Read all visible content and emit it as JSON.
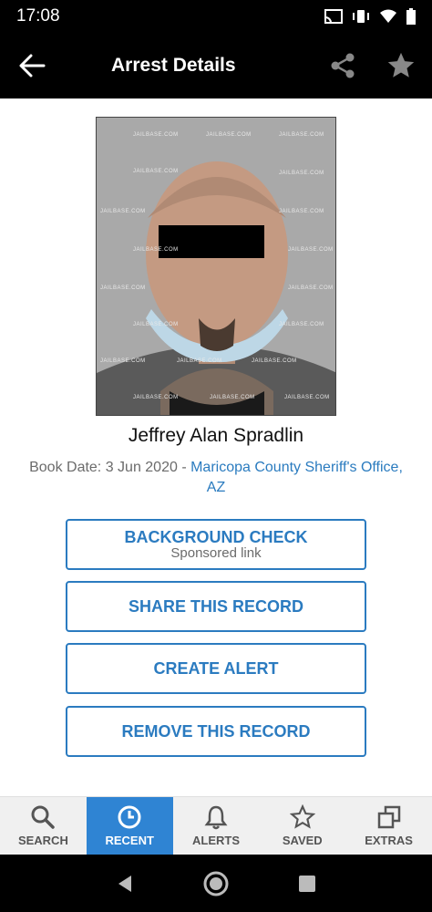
{
  "status_bar": {
    "time": "17:08"
  },
  "app_bar": {
    "title": "Arrest Details"
  },
  "record": {
    "name": "Jeffrey Alan Spradlin",
    "book_date_label": "Book Date: 3 Jun 2020 - ",
    "agency": "Maricopa County Sheriff's Office, AZ",
    "watermark": "JAILBASE.COM"
  },
  "actions": {
    "background_check": "BACKGROUND CHECK",
    "background_check_sub": "Sponsored link",
    "share_record": "SHARE THIS RECORD",
    "create_alert": "CREATE ALERT",
    "remove_record": "REMOVE THIS RECORD"
  },
  "bottom_nav": {
    "search": "SEARCH",
    "recent": "RECENT",
    "alerts": "ALERTS",
    "saved": "SAVED",
    "extras": "EXTRAS"
  },
  "colors": {
    "accent": "#2b7bc0",
    "active_tab": "#2f84d3"
  }
}
